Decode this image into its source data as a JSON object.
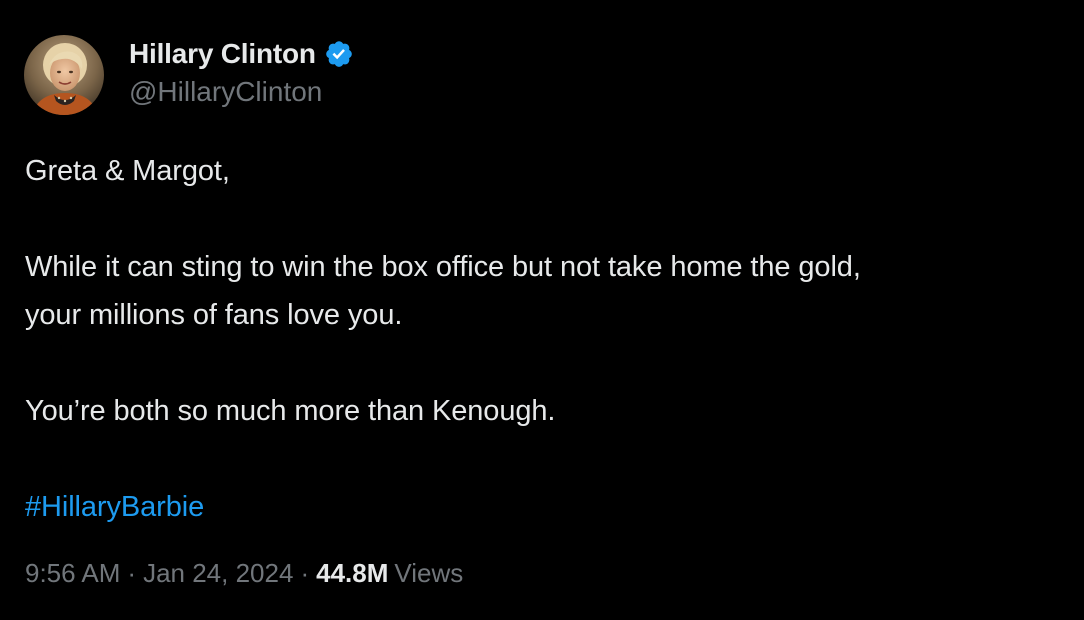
{
  "author": {
    "display_name": "Hillary Clinton",
    "handle": "@HillaryClinton",
    "verified_icon": "verified-badge-icon",
    "verified_color": "#1d9bf0"
  },
  "tweet": {
    "greeting": "Greta & Margot,",
    "line1": "While it can sting to win the box office but not take home the gold,",
    "line2": "your millions of fans love you.",
    "line3": "You’re both so much more than Kenough.",
    "hashtag": "#HillaryBarbie"
  },
  "meta": {
    "time": "9:56 AM",
    "separator": "·",
    "date": "Jan 24, 2024",
    "views_count": "44.8M",
    "views_label": "Views"
  },
  "colors": {
    "background": "#000000",
    "text": "#e7e9ea",
    "secondary": "#71767b",
    "link": "#1d9bf0"
  }
}
